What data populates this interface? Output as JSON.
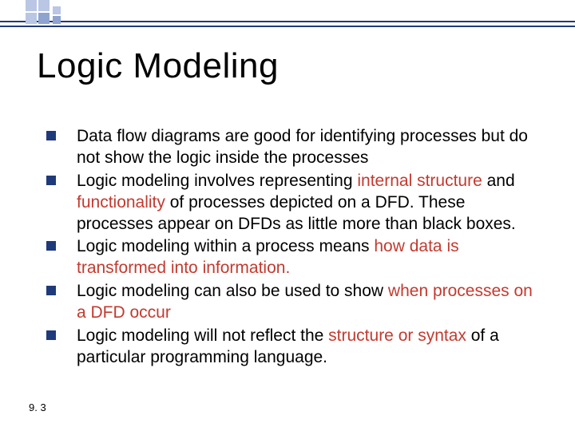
{
  "title": "Logic Modeling",
  "pageNumber": "9. 3",
  "bullets": [
    {
      "pre": "Data flow diagrams are good for identifying processes but do not show the logic inside the processes",
      "hl1": "",
      "mid": "",
      "hl2": "",
      "post": ""
    },
    {
      "pre": "Logic modeling involves representing ",
      "hl1": "internal structure",
      "mid": " and ",
      "hl2": "functionality",
      "post": " of processes depicted on a DFD. These processes appear on DFDs as little more than black boxes."
    },
    {
      "pre": "Logic modeling within a process means ",
      "hl1": "how data is transformed into information.",
      "mid": "",
      "hl2": "",
      "post": ""
    },
    {
      "pre": "Logic modeling can also be used to show ",
      "hl1": "when processes on a DFD occur",
      "mid": "",
      "hl2": "",
      "post": ""
    },
    {
      "pre": "Logic modeling will not reflect the ",
      "hl1": "structure or syntax",
      "mid": " of a particular programming language.",
      "hl2": "",
      "post": ""
    }
  ]
}
